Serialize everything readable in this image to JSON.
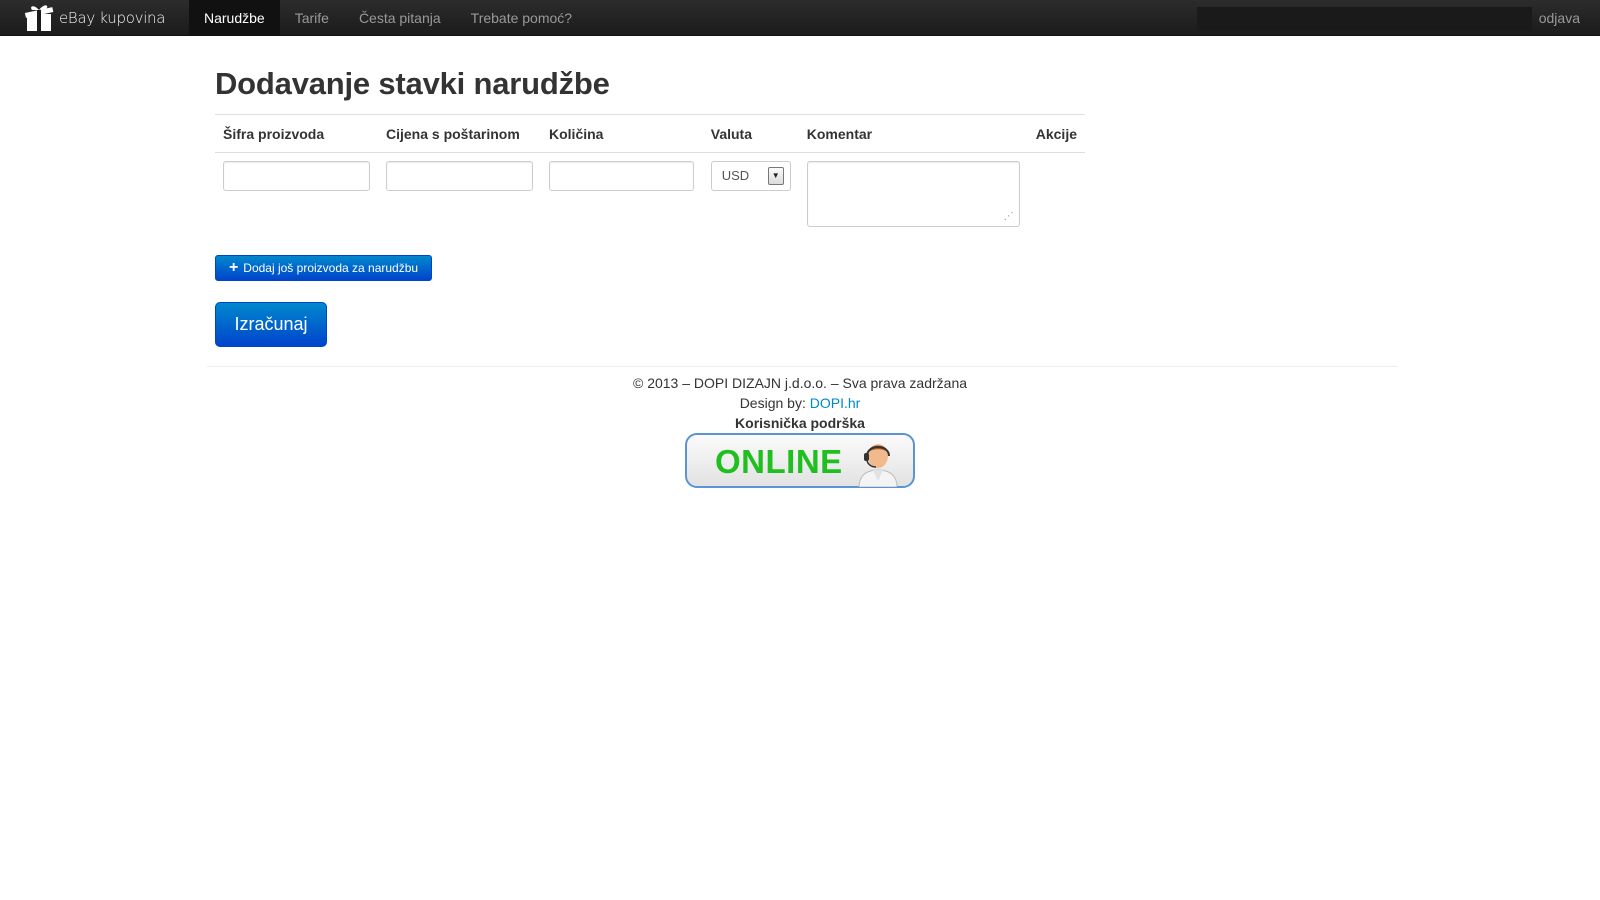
{
  "navbar": {
    "brand": "eBay kupovina",
    "items": [
      {
        "label": "Narudžbe",
        "active": true
      },
      {
        "label": "Tarife",
        "active": false
      },
      {
        "label": "Česta pitanja",
        "active": false
      },
      {
        "label": "Trebate pomoć?",
        "active": false
      }
    ],
    "logout": "odjava"
  },
  "main": {
    "title": "Dodavanje stavki narudžbe",
    "table": {
      "headers": [
        "Šifra proizvoda",
        "Cijena s poštarinom",
        "Količina",
        "Valuta",
        "Komentar",
        "Akcije"
      ],
      "row": {
        "product_code": "",
        "price": "",
        "quantity": "",
        "currency": "USD",
        "comment": ""
      }
    },
    "add_button": "Dodaj još proizvoda za narudžbu",
    "calculate_button": "Izračunaj"
  },
  "footer": {
    "copyright": "© 2013 – DOPI DIZAJN j.d.o.o. – Sva prava zadržana",
    "design_by": "Design by: ",
    "design_link": "DOPI.hr",
    "support_title": "Korisnička podrška",
    "online_label": "ONLINE"
  },
  "colors": {
    "navbar": "#1b1b1b",
    "primary_button": "#0044cc",
    "link": "#0088cc",
    "online_green": "#1fbf1f"
  }
}
